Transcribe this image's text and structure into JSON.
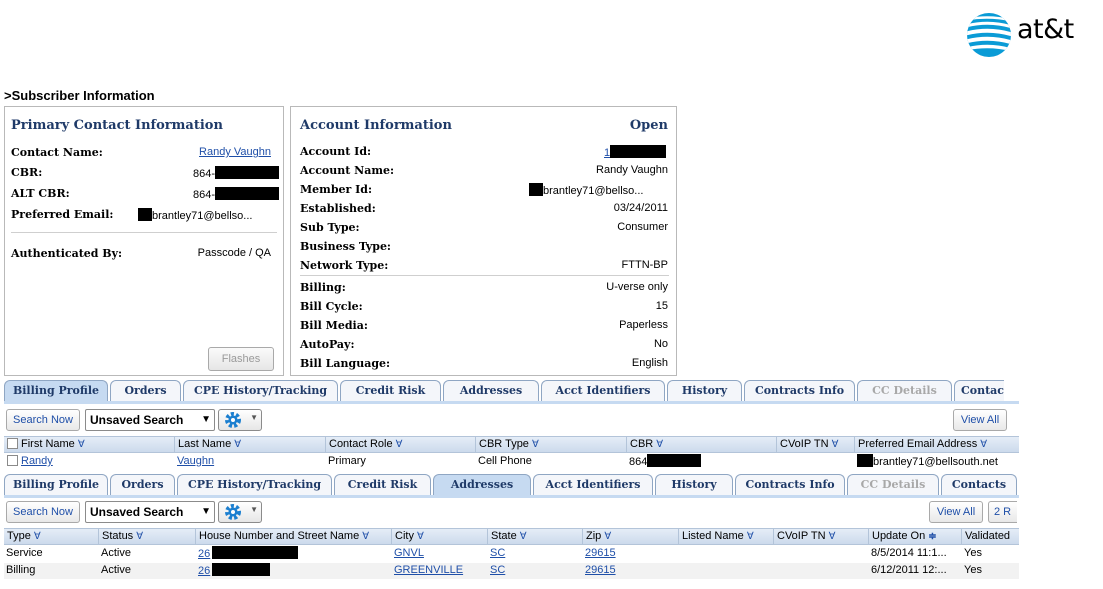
{
  "brand": {
    "logo_text": "at&t",
    "globe_color": "#0a9bd6"
  },
  "section_title": ">Subscriber Information",
  "primary_contact": {
    "title": "Primary Contact Information",
    "rows": [
      {
        "label": "Contact Name:",
        "value": "Randy Vaughn"
      },
      {
        "label": "CBR:",
        "value": "864-"
      },
      {
        "label": "ALT CBR:",
        "value": "864-"
      },
      {
        "label": "Preferred Email:",
        "value": "brantley71@bellso..."
      },
      {
        "label": "Authenticated By:",
        "value": "Passcode / QA"
      }
    ],
    "flashes_label": "Flashes"
  },
  "account_info": {
    "title": "Account Information",
    "status": "Open",
    "rows": [
      {
        "label": "Account Id:",
        "value": "1"
      },
      {
        "label": "Account Name:",
        "value": "Randy Vaughn"
      },
      {
        "label": "Member Id:",
        "value": "brantley71@bellso..."
      },
      {
        "label": "Established:",
        "value": "03/24/2011"
      },
      {
        "label": "Sub Type:",
        "value": "Consumer"
      },
      {
        "label": "Business Type:",
        "value": ""
      },
      {
        "label": "Network Type:",
        "value": "FTTN-BP"
      },
      {
        "label": "Billing:",
        "value": "U-verse only"
      },
      {
        "label": "Bill Cycle:",
        "value": "15"
      },
      {
        "label": "Bill Media:",
        "value": "Paperless"
      },
      {
        "label": "AutoPay:",
        "value": "No"
      },
      {
        "label": "Bill Language:",
        "value": "English"
      }
    ]
  },
  "tabs_top": [
    "Billing Profile",
    "Orders",
    "CPE History/Tracking",
    "Credit Risk",
    "Addresses",
    "Acct Identifiers",
    "History",
    "Contracts Info",
    "CC Details",
    "Contac"
  ],
  "tabs_bottom": [
    "Billing Profile",
    "Orders",
    "CPE History/Tracking",
    "Credit Risk",
    "Addresses",
    "Acct Identifiers",
    "History",
    "Contracts Info",
    "CC Details",
    "Contacts"
  ],
  "toolbar": {
    "search_now": "Search Now",
    "saved_search": "Unsaved Search",
    "view_all": "View All",
    "page_count": "2 R"
  },
  "contacts_grid": {
    "headers": [
      "First Name",
      "Last Name",
      "Contact Role",
      "CBR Type",
      "CBR",
      "CVoIP TN",
      "Preferred Email Address"
    ],
    "row": {
      "first": "Randy",
      "last": "Vaughn",
      "role": "Primary",
      "cbr_type": "Cell Phone",
      "cbr": "864",
      "cvoip": "",
      "email": "brantley71@bellsouth.net"
    }
  },
  "addresses_grid": {
    "headers": [
      "Type",
      "Status",
      "House Number and Street Name",
      "City",
      "State",
      "Zip",
      "Listed Name",
      "CVoIP TN",
      "Update On",
      "Validated"
    ],
    "rows": [
      {
        "type": "Service",
        "status": "Active",
        "house": "26",
        "city": "GNVL",
        "state": "SC",
        "zip": "29615",
        "listed": "",
        "cvoip": "",
        "update": "8/5/2014 11:1...",
        "validated": "Yes"
      },
      {
        "type": "Billing",
        "status": "Active",
        "house": "26",
        "city": "GREENVILLE",
        "state": "SC",
        "zip": "29615",
        "listed": "",
        "cvoip": "",
        "update": "6/12/2011 12:...",
        "validated": "Yes"
      }
    ]
  }
}
